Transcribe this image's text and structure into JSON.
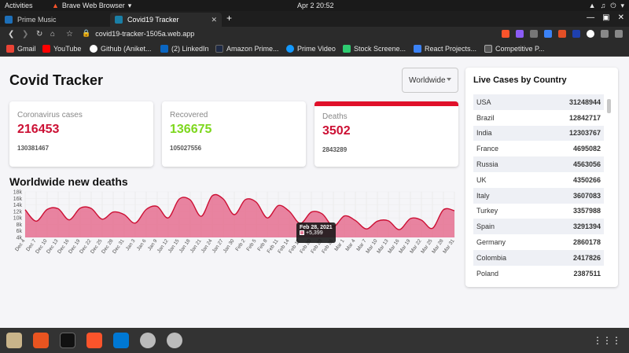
{
  "system": {
    "activities": "Activities",
    "app_name": "Brave Web Browser",
    "clock": "Apr 2  20:52"
  },
  "browser": {
    "tabs": [
      {
        "title": "Prime Music",
        "active": false
      },
      {
        "title": "Covid19 Tracker",
        "active": true
      }
    ],
    "url": "covid19-tracker-1505a.web.app",
    "bookmarks": [
      {
        "label": "Gmail",
        "color": "#ea4335"
      },
      {
        "label": "YouTube",
        "color": "#ff0000"
      },
      {
        "label": "Github (Aniket...",
        "color": "#ffffff"
      },
      {
        "label": "(2) LinkedIn",
        "color": "#0a66c2"
      },
      {
        "label": "Amazon Prime...",
        "color": "#1f2a44"
      },
      {
        "label": "Prime Video",
        "color": "#1399ff"
      },
      {
        "label": "Stock Screene...",
        "color": "#2ecc71"
      },
      {
        "label": "React Projects...",
        "color": "#3b82f6"
      },
      {
        "label": "Competitive P...",
        "color": "#555555"
      }
    ]
  },
  "app": {
    "title": "Covid Tracker",
    "country_select": "Worldwide",
    "cards": [
      {
        "label": "Coronavirus cases",
        "today": "216453",
        "total": "130381467",
        "color": "#cc1034",
        "active": false
      },
      {
        "label": "Recovered",
        "today": "136675",
        "total": "105027556",
        "color": "#7dd71d",
        "active": false
      },
      {
        "label": "Deaths",
        "today": "3502",
        "total": "2843289",
        "color": "#cc1034",
        "active": true
      }
    ],
    "graph_title": "Worldwide new deaths",
    "tooltip": {
      "date": "Feb 28, 2021",
      "value": "+5,399"
    },
    "live_title": "Live Cases by Country",
    "countries": [
      {
        "name": "USA",
        "cases": "31248944"
      },
      {
        "name": "Brazil",
        "cases": "12842717"
      },
      {
        "name": "India",
        "cases": "12303767"
      },
      {
        "name": "France",
        "cases": "4695082"
      },
      {
        "name": "Russia",
        "cases": "4563056"
      },
      {
        "name": "UK",
        "cases": "4350266"
      },
      {
        "name": "Italy",
        "cases": "3607083"
      },
      {
        "name": "Turkey",
        "cases": "3357988"
      },
      {
        "name": "Spain",
        "cases": "3291394"
      },
      {
        "name": "Germany",
        "cases": "2860178"
      },
      {
        "name": "Colombia",
        "cases": "2417826"
      },
      {
        "name": "Poland",
        "cases": "2387511"
      }
    ]
  },
  "chart_data": {
    "type": "area",
    "title": "Worldwide new deaths",
    "ylim": [
      4000,
      18000
    ],
    "y_ticks": [
      "4k",
      "6k",
      "8k",
      "10k",
      "12k",
      "14k",
      "16k",
      "18k"
    ],
    "x": [
      "Dec 4",
      "Dec 7",
      "Dec 10",
      "Dec 13",
      "Dec 16",
      "Dec 19",
      "Dec 22",
      "Dec 25",
      "Dec 28",
      "Dec 31",
      "Jan 3",
      "Jan 6",
      "Jan 9",
      "Jan 12",
      "Jan 15",
      "Jan 18",
      "Jan 21",
      "Jan 24",
      "Jan 27",
      "Jan 30",
      "Feb 2",
      "Feb 5",
      "Feb 8",
      "Feb 11",
      "Feb 14",
      "Feb 17",
      "Feb 20",
      "Feb 23",
      "Feb 26",
      "Mar 1",
      "Mar 4",
      "Mar 7",
      "Mar 10",
      "Mar 13",
      "Mar 16",
      "Mar 19",
      "Mar 22",
      "Mar 25",
      "Mar 28",
      "Mar 31"
    ],
    "values": [
      12500,
      9000,
      12600,
      12800,
      9400,
      13000,
      12900,
      9600,
      11800,
      11000,
      8400,
      12600,
      13500,
      10000,
      15800,
      15500,
      10500,
      16800,
      15800,
      11000,
      15600,
      14800,
      10000,
      13800,
      12000,
      8300,
      11800,
      11200,
      7400,
      10600,
      9200,
      6600,
      9000,
      9100,
      6400,
      9800,
      9300,
      6800,
      12500,
      12200
    ],
    "series_color": "#cc1034",
    "fill_color": "#e5678a"
  }
}
